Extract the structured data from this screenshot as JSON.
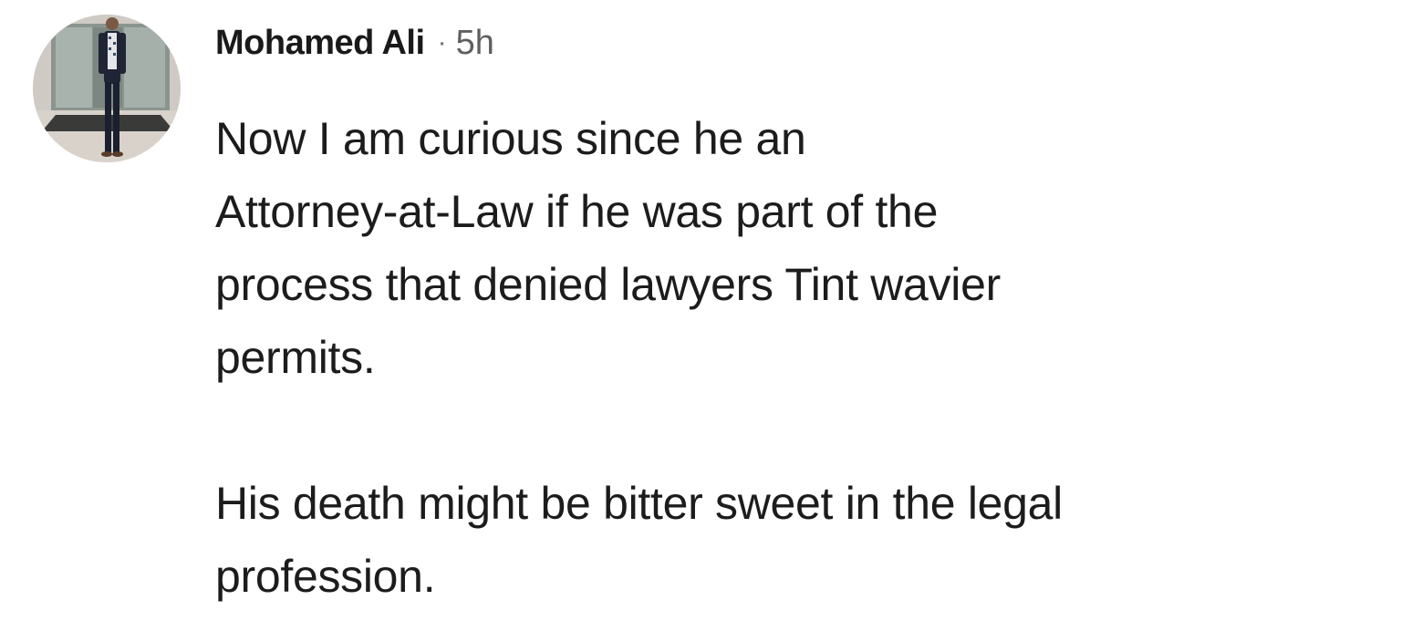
{
  "comment": {
    "author": "Mohamed Ali",
    "separator": "·",
    "time": "5h",
    "avatar_icon": "profile-photo",
    "paragraphs": [
      {
        "lines": [
          "Now I am curious since he an",
          "Attorney-at-Law if he was part of the",
          "process that denied lawyers Tint wavier",
          "permits."
        ]
      },
      {
        "lines": [
          "His death might be bitter sweet in the legal",
          "profession."
        ]
      }
    ]
  }
}
